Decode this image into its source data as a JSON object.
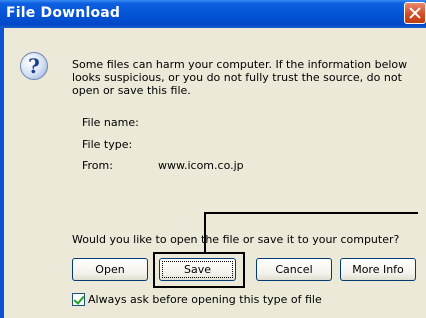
{
  "window": {
    "title": "File Download"
  },
  "message": "Some files can harm your computer. If the information below looks suspicious, or you do not fully trust the source, do not open or save this file.",
  "fields": {
    "file_name_label": "File name:",
    "file_type_label": "File type:",
    "from_label": "From:",
    "from_value": "www.icom.co.jp"
  },
  "question": "Would you like to open the file or save it to your computer?",
  "buttons": {
    "open": "Open",
    "save": "Save",
    "cancel": "Cancel",
    "more_info": "More Info"
  },
  "checkbox": {
    "label": "Always ask before opening this type of file",
    "checked": true
  }
}
